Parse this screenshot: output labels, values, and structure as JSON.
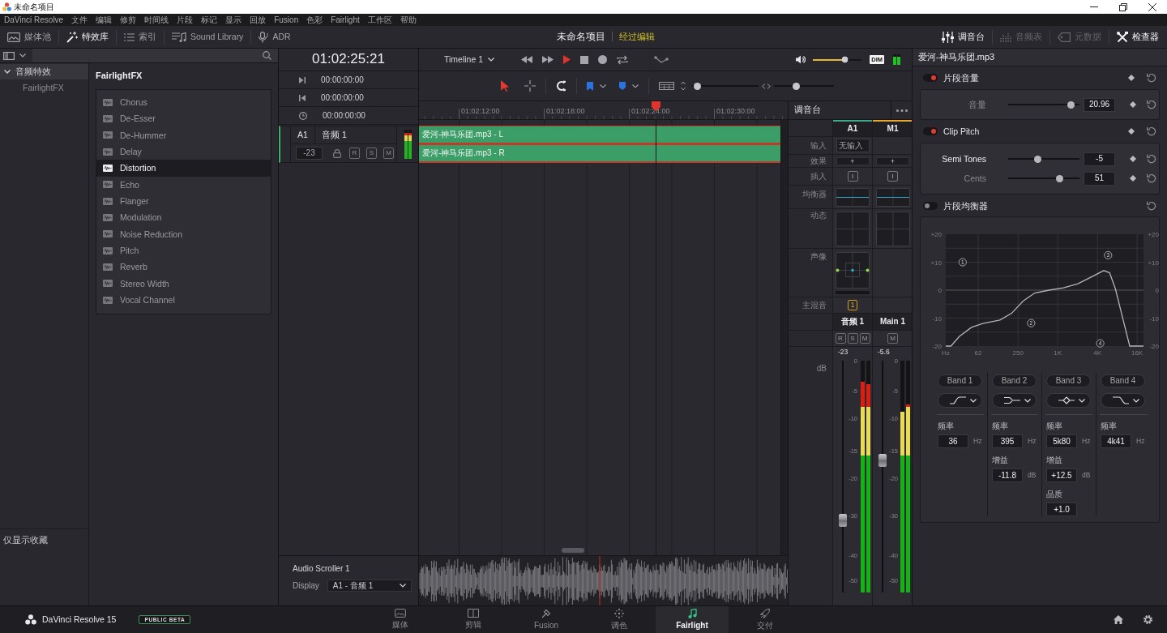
{
  "title_bar": {
    "title": "未命名项目"
  },
  "menu": [
    "DaVinci Resolve",
    "文件",
    "编辑",
    "修剪",
    "时间线",
    "片段",
    "标记",
    "显示",
    "回放",
    "Fusion",
    "色彩",
    "Fairlight",
    "工作区",
    "帮助"
  ],
  "toolbar": {
    "left": [
      {
        "label": "媒体池",
        "kind": "media",
        "selected": false
      },
      {
        "label": "特效库",
        "kind": "effects",
        "selected": true
      },
      {
        "label": "索引",
        "kind": "index",
        "selected": false
      },
      {
        "label": "Sound Library",
        "kind": "library",
        "selected": false
      },
      {
        "label": "ADR",
        "kind": "adr",
        "selected": false
      }
    ],
    "project": "未命名项目",
    "status": "经过编辑",
    "right": [
      {
        "label": "调音台",
        "kind": "mixer",
        "selected": true,
        "disabled": false
      },
      {
        "label": "音频表",
        "kind": "meters",
        "selected": false,
        "disabled": true
      },
      {
        "label": "元数据",
        "kind": "metadata",
        "selected": false,
        "disabled": true
      },
      {
        "label": "检查器",
        "kind": "inspector",
        "selected": true,
        "disabled": false
      }
    ]
  },
  "browser": {
    "tree": [
      {
        "label": "音频特效",
        "expanded": true,
        "selected": true,
        "children": [
          {
            "label": "FairlightFX",
            "selected": false
          }
        ]
      }
    ],
    "favorites": "仅显示收藏",
    "title": "FairlightFX",
    "effects": [
      {
        "label": "Chorus",
        "selected": false
      },
      {
        "label": "De-Esser",
        "selected": false
      },
      {
        "label": "De-Hummer",
        "selected": false
      },
      {
        "label": "Delay",
        "selected": false
      },
      {
        "label": "Distortion",
        "selected": true
      },
      {
        "label": "Echo",
        "selected": false
      },
      {
        "label": "Flanger",
        "selected": false
      },
      {
        "label": "Modulation",
        "selected": false
      },
      {
        "label": "Noise Reduction",
        "selected": false
      },
      {
        "label": "Pitch",
        "selected": false
      },
      {
        "label": "Reverb",
        "selected": false
      },
      {
        "label": "Stereo Width",
        "selected": false
      },
      {
        "label": "Vocal Channel",
        "selected": false
      }
    ]
  },
  "track_panel": {
    "timecode": "01:02:25:21",
    "rows": [
      {
        "kind": "end",
        "value": "00:00:00:00"
      },
      {
        "kind": "start",
        "value": "00:00:00:00"
      },
      {
        "kind": "duration",
        "value": "00:00:00:00"
      }
    ],
    "tracks": [
      {
        "id": "A1",
        "name": "音频 1",
        "volume": "-23",
        "buttons": [
          "R",
          "S",
          "M"
        ],
        "meters": [
          {
            "level": 0.9
          },
          {
            "level": 0.88
          }
        ]
      }
    ]
  },
  "timeline": {
    "name": "Timeline 1",
    "monitor": {
      "level": 0.73,
      "dim": "DIM",
      "meters": [
        {
          "level": 0.78
        },
        {
          "level": 0.78
        }
      ]
    },
    "tools": [
      {
        "kind": "pointer",
        "selected": true
      },
      {
        "kind": "range",
        "selected": false
      }
    ],
    "zoom_sliders": [
      {
        "level": 0.03
      },
      {
        "level": 0.35
      }
    ],
    "ruler": [
      "01:02:12:00",
      "01:02:18:00",
      "01:02:24:00",
      "01:02:30:00"
    ],
    "playhead": {
      "level": 0.655
    },
    "clips": [
      "爱河-神马乐团.mp3 - L",
      "爱河-神马乐团.mp3 - R"
    ]
  },
  "scroller": {
    "title": "Audio Scroller 1",
    "display_label": "Display",
    "display_value": "A1 - 音频 1"
  },
  "mixer": {
    "title": "调音台",
    "row_labels": [
      "输入",
      "效果",
      "插入",
      "均衡器",
      "动态",
      "声像",
      "主混音"
    ],
    "db_label": "dB",
    "channels": [
      {
        "id": "A1",
        "kind": "track",
        "color": "#3fa98a",
        "input": "无输入",
        "effects": "+",
        "insert": "I",
        "bus": "1",
        "name": "音频 1",
        "buttons": [
          "R",
          "S",
          "M"
        ],
        "gain": "-23",
        "scale": [
          "0",
          "-5",
          "-10",
          "-15",
          "-20",
          "-30",
          "-40",
          "-50"
        ],
        "fader": {
          "level": 0.31
        },
        "meters": [
          {
            "level": 0.91
          },
          {
            "level": 0.9
          }
        ]
      },
      {
        "id": "M1",
        "kind": "bus",
        "color": "#e8a530",
        "effects": "+",
        "insert": "I",
        "name": "Main 1",
        "buttons": [
          "M"
        ],
        "gain": "-5.6",
        "scale": [
          "0",
          "-5",
          "-10",
          "-15",
          "-20",
          "-30",
          "-40",
          "-50"
        ],
        "fader": {
          "level": 0.57
        },
        "meters": [
          {
            "level": 0.78
          },
          {
            "level": 0.81
          }
        ]
      }
    ]
  },
  "inspector": {
    "clip": "爱河-神马乐团.mp3",
    "sections": [
      {
        "title": "片段音量",
        "on": true,
        "params": [
          {
            "label": "音量",
            "value": "20.96",
            "level": 0.92,
            "selected": false
          }
        ]
      },
      {
        "title": "Clip Pitch",
        "on": true,
        "params": [
          {
            "label": "Semi Tones",
            "value": "-5",
            "level": 0.41,
            "selected": true
          },
          {
            "label": "Cents",
            "value": "51",
            "level": 0.75,
            "selected": false
          }
        ]
      }
    ],
    "eq": {
      "title": "片段均衡器",
      "on": false,
      "chart_data": {
        "type": "line",
        "log": "x",
        "x": [
          20,
          24,
          32,
          49,
          73,
          133,
          199,
          298,
          446,
          736,
          1220,
          2020,
          3340,
          5000,
          6130,
          7480,
          9640,
          12350,
          20000
        ],
        "values": [
          -20,
          -20,
          -16.6,
          -13.3,
          -11.9,
          -10.7,
          -8.3,
          -3.9,
          -1,
          0,
          0.8,
          2.3,
          4.9,
          7,
          6.2,
          0.5,
          -9.8,
          -20,
          -20
        ],
        "color": "#b4b4b8",
        "xlim": [
          20,
          20000
        ],
        "ylim": [
          -20,
          20
        ],
        "y2lim": [
          -20,
          20
        ],
        "xticks": [
          {
            "value": 20,
            "label": "Hz"
          },
          {
            "value": 62,
            "label": "62"
          },
          {
            "value": 250,
            "label": "250"
          },
          {
            "value": 1000,
            "label": "1K"
          },
          {
            "value": 4000,
            "label": "4K"
          },
          {
            "value": 16000,
            "label": "16K"
          }
        ],
        "yticks": [
          {
            "value": 20,
            "label": "+20"
          },
          {
            "value": 10,
            "label": "+10"
          },
          {
            "value": 0,
            "label": "0"
          },
          {
            "value": -10,
            "label": "-10"
          },
          {
            "value": -20,
            "label": "-20"
          }
        ],
        "y2ticks": [
          {
            "value": 20,
            "label": "+20"
          },
          {
            "value": 10,
            "label": "+10"
          },
          {
            "value": 0,
            "label": "0"
          },
          {
            "value": -10,
            "label": "-10"
          },
          {
            "value": -20,
            "label": "-20"
          }
        ],
        "grid": true,
        "annotations": [
          "1",
          "2",
          "3",
          "4"
        ]
      },
      "bands": [
        {
          "label": "Band 1",
          "kind": "lowcut",
          "fields": [
            {
              "label": "频率",
              "value": "36",
              "unit": "Hz"
            }
          ]
        },
        {
          "label": "Band 2",
          "kind": "shelf",
          "fields": [
            {
              "label": "频率",
              "value": "395",
              "unit": "Hz"
            },
            {
              "label": "增益",
              "value": "-11.8",
              "unit": "dB"
            }
          ]
        },
        {
          "label": "Band 3",
          "kind": "bell",
          "fields": [
            {
              "label": "频率",
              "value": "5k80",
              "unit": "Hz"
            },
            {
              "label": "增益",
              "value": "+12.5",
              "unit": "dB"
            },
            {
              "label": "品质",
              "value": "+1.0"
            }
          ]
        },
        {
          "label": "Band 4",
          "kind": "highcut",
          "fields": [
            {
              "label": "频率",
              "value": "4k41",
              "unit": "Hz"
            }
          ]
        }
      ]
    }
  },
  "bottom": {
    "app": "DaVinci Resolve 15",
    "badge": "PUBLIC BETA",
    "pages": [
      {
        "label": "媒体",
        "kind": "media",
        "selected": false
      },
      {
        "label": "剪辑",
        "kind": "edit",
        "selected": false
      },
      {
        "label": "Fusion",
        "kind": "fusion",
        "selected": false
      },
      {
        "label": "调色",
        "kind": "color",
        "selected": false
      },
      {
        "label": "Fairlight",
        "kind": "fairlight",
        "selected": true
      },
      {
        "label": "交付",
        "kind": "deliver",
        "selected": false
      }
    ]
  }
}
